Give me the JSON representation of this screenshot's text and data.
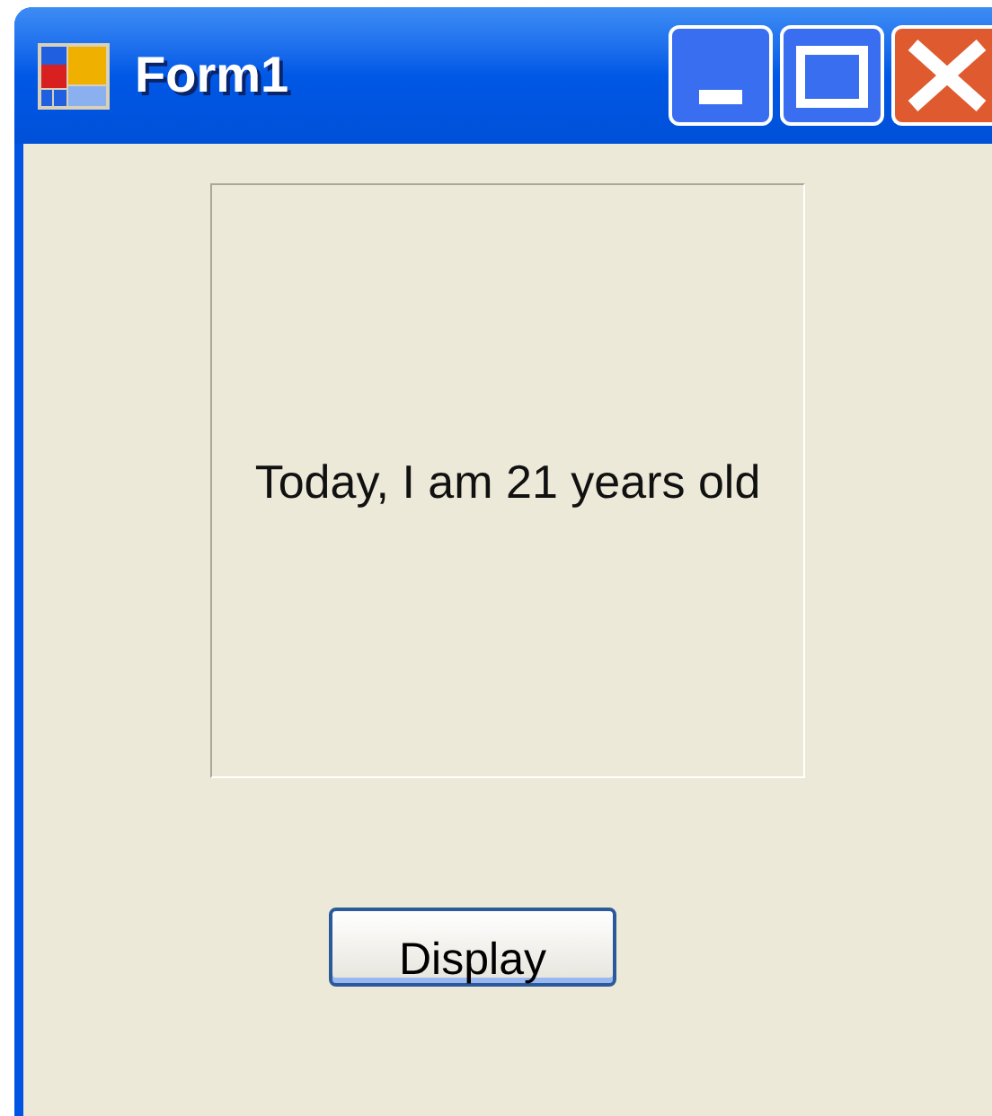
{
  "window": {
    "title": "Form1"
  },
  "label": {
    "text": "Today, I am 21 years old"
  },
  "button": {
    "label": "Display"
  }
}
